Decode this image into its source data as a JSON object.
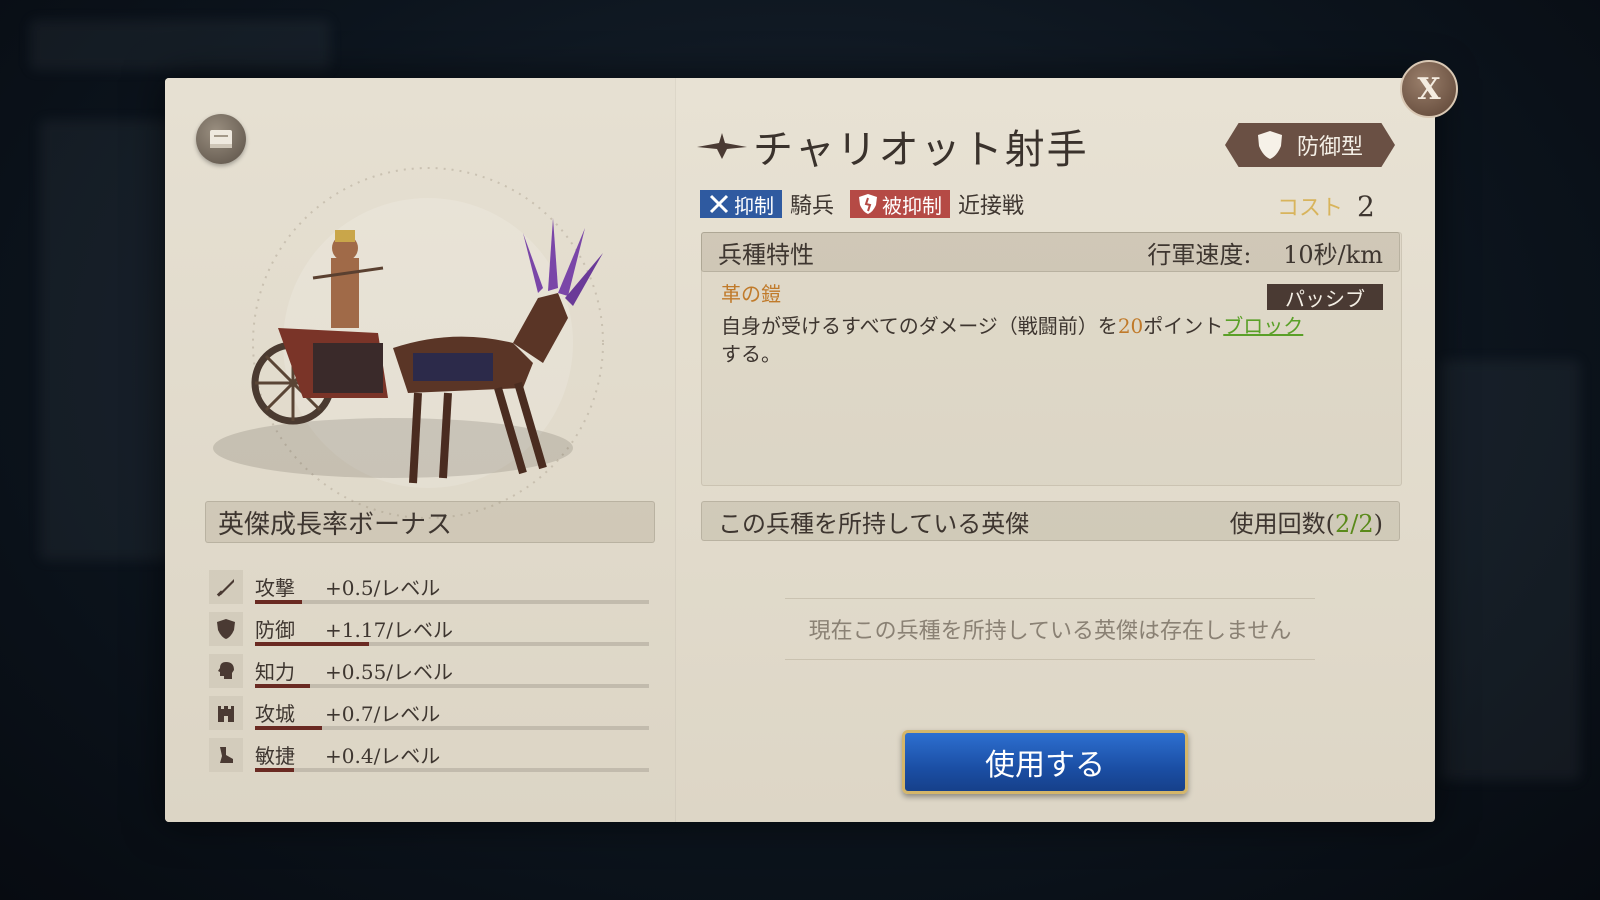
{
  "window": {
    "close_label": "X"
  },
  "unit": {
    "name": "チャリオット射手",
    "type_badge": "防御型",
    "tags": {
      "counter_label": "抑制",
      "counter_target": "騎兵",
      "countered_label": "被抑制",
      "countered_by": "近接戦"
    },
    "cost": {
      "label": "コスト",
      "value": "2"
    }
  },
  "growth": {
    "title": "英傑成長率ボーナス",
    "stats": [
      {
        "icon": "sword-icon",
        "label": "攻撃",
        "value": "+0.5/レベル",
        "fill": 0.12
      },
      {
        "icon": "shield-icon",
        "label": "防御",
        "value": "+1.17/レベル",
        "fill": 0.29
      },
      {
        "icon": "head-icon",
        "label": "知力",
        "value": "+0.55/レベル",
        "fill": 0.14
      },
      {
        "icon": "castle-icon",
        "label": "攻城",
        "value": "+0.7/レベル",
        "fill": 0.17
      },
      {
        "icon": "boot-icon",
        "label": "敏捷",
        "value": "+0.4/レベル",
        "fill": 0.1
      }
    ]
  },
  "traits": {
    "header": "兵種特性",
    "march_speed_label": "行軍速度:",
    "march_speed_value": "10秒/km",
    "skill_name": "革の鎧",
    "skill_type": "パッシブ",
    "desc_before": "自身が受けるすべてのダメージ（戦闘前）を",
    "desc_number": "20",
    "desc_mid": "ポイント",
    "desc_link": "ブロック",
    "desc_after": "する。"
  },
  "heroes": {
    "header": "この兵種を所持している英傑",
    "usage_prefix": "使用回数(",
    "usage_value": "2/2",
    "usage_suffix": ")",
    "empty_message": "現在この兵種を所持している英傑は存在しません"
  },
  "actions": {
    "use_button": "使用する"
  }
}
